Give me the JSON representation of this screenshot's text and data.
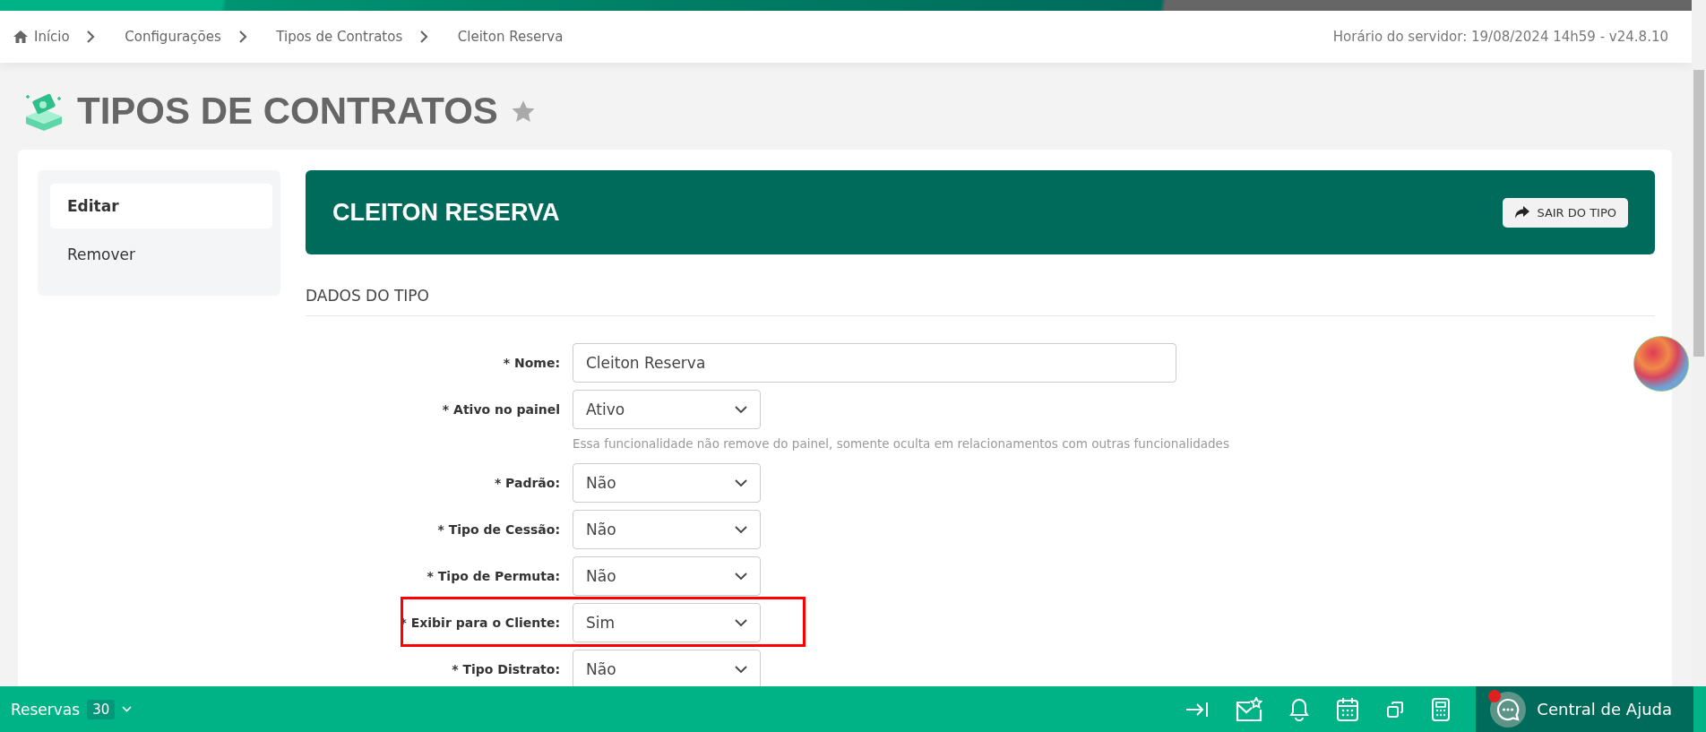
{
  "breadcrumb": [
    "Início",
    "Configurações",
    "Tipos de Contratos",
    "Cleiton Reserva"
  ],
  "server_time": "Horário do servidor: 19/08/2024 14h59 - v24.8.10",
  "page_title": "TIPOS DE CONTRATOS",
  "favorite": false,
  "sidebar": {
    "items": [
      {
        "label": "Editar",
        "selected": true
      },
      {
        "label": "Remover",
        "selected": false
      }
    ]
  },
  "header": {
    "title": "CLEITON RESERVA",
    "button": "SAIR DO TIPO"
  },
  "section_title": "DADOS DO TIPO",
  "fields": [
    {
      "kind": "text",
      "label": "* Nome:",
      "value": "Cleiton Reserva",
      "highlighted": false
    },
    {
      "kind": "select",
      "label": "* Ativo no painel",
      "value": "Ativo",
      "hint": "Essa funcionalidade não remove do painel, somente oculta em relacionamentos com outras funcionalidades",
      "highlighted": false
    },
    {
      "kind": "select",
      "label": "* Padrão:",
      "value": "Não",
      "highlighted": false
    },
    {
      "kind": "select",
      "label": "* Tipo de Cessão:",
      "value": "Não",
      "highlighted": false
    },
    {
      "kind": "select",
      "label": "* Tipo de Permuta:",
      "value": "Não",
      "highlighted": false
    },
    {
      "kind": "select",
      "label": "* Exibir para o Cliente:",
      "value": "Sim",
      "highlighted": true
    },
    {
      "kind": "select",
      "label": "* Tipo Distrato:",
      "value": "Não",
      "highlighted": false
    }
  ],
  "bottom_bar": {
    "label": "Reservas",
    "count": "30",
    "help": "Central de Ajuda",
    "help_notification": true
  }
}
